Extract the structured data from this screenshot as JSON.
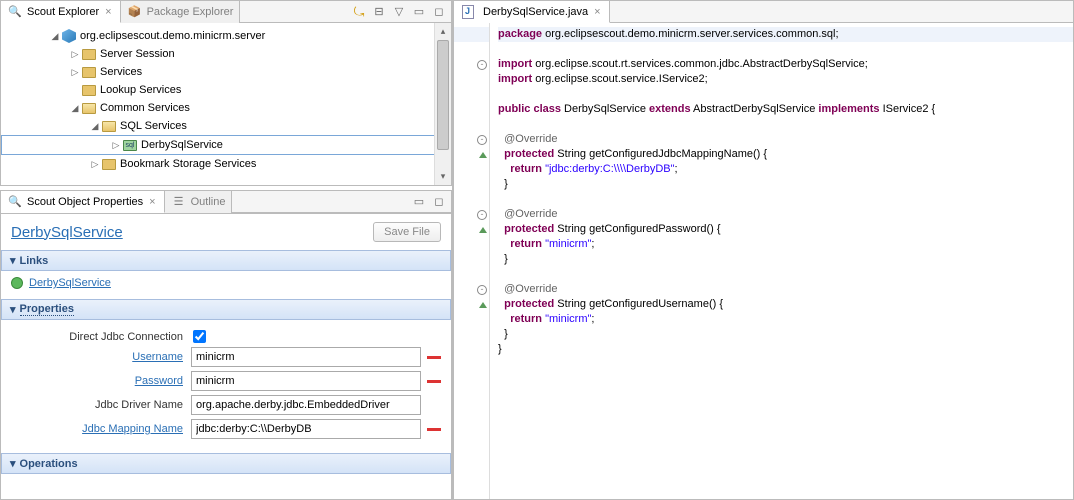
{
  "tabs": {
    "scout_explorer": "Scout Explorer",
    "package_explorer": "Package Explorer",
    "scout_props": "Scout Object Properties",
    "outline": "Outline",
    "editor_file": "DerbySqlService.java"
  },
  "tree": {
    "root": "org.eclipsescout.demo.minicrm.server",
    "n1": "Server Session",
    "n2": "Services",
    "n3": "Lookup Services",
    "n4": "Common Services",
    "n5": "SQL Services",
    "n6": "DerbySqlService",
    "n7": "Bookmark Storage Services"
  },
  "props": {
    "title": "DerbySqlService",
    "save": "Save File",
    "sec_links": "Links",
    "link1": "DerbySqlService",
    "sec_props": "Properties",
    "lbl_direct": "Direct Jdbc Connection",
    "lbl_user": "Username",
    "val_user": "minicrm",
    "lbl_pass": "Password",
    "val_pass": "minicrm",
    "lbl_driver": "Jdbc Driver Name",
    "val_driver": "org.apache.derby.jdbc.EmbeddedDriver",
    "lbl_mapping": "Jdbc Mapping Name",
    "val_mapping": "jdbc:derby:C:\\\\DerbyDB",
    "sec_ops": "Operations"
  },
  "code": {
    "l1a": "package",
    "l1b": " org.eclipsescout.demo.minicrm.server.services.common.sql;",
    "l2a": "import",
    "l2b": " org.eclipse.scout.rt.services.common.jdbc.AbstractDerbySqlService;",
    "l3a": "import",
    "l3b": " org.eclipse.scout.service.IService2;",
    "l4a": "public",
    "l4b": "class",
    "l4c": " DerbySqlService ",
    "l4d": "extends",
    "l4e": " AbstractDerbySqlService ",
    "l4f": "implements",
    "l4g": " IService2 {",
    "ov": "@Override",
    "m1a": "protected",
    "m1b": " String getConfiguredJdbcMappingName() {",
    "r": "return",
    "s1": "\"jdbc:derby:C:\\\\\\\\DerbyDB\"",
    "semi": ";",
    "cb": "  }",
    "m2b": " String getConfiguredPassword() {",
    "s2": "\"minicrm\"",
    "m3b": " String getConfiguredUsername() {",
    "cb2": "}"
  }
}
